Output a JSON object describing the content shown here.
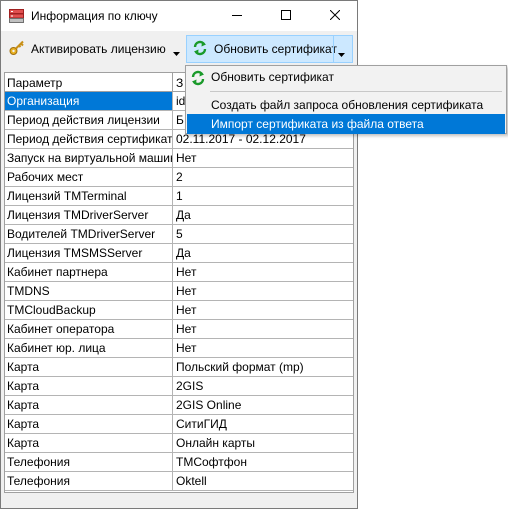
{
  "window": {
    "title": "Информация по ключу"
  },
  "toolbar": {
    "activate_label": "Активировать лицензию",
    "update_label": "Обновить сертификат"
  },
  "grid": {
    "headers": [
      "Параметр",
      "З"
    ],
    "rows": [
      {
        "key": "Организация",
        "value": "id"
      },
      {
        "key": "Период действия лицензии",
        "value": "Б"
      },
      {
        "key": "Период действия сертификата",
        "value": "02.11.2017 - 02.12.2017"
      },
      {
        "key": "Запуск на виртуальной машине",
        "value": "Нет"
      },
      {
        "key": "Рабочих мест",
        "value": "2"
      },
      {
        "key": "Лицензий TMTerminal",
        "value": "1"
      },
      {
        "key": "Лицензия TMDriverServer",
        "value": "Да"
      },
      {
        "key": "Водителей TMDriverServer",
        "value": "5"
      },
      {
        "key": "Лицензия TMSMSServer",
        "value": "Да"
      },
      {
        "key": "Кабинет партнера",
        "value": "Нет"
      },
      {
        "key": "TMDNS",
        "value": "Нет"
      },
      {
        "key": "TMCloudBackup",
        "value": "Нет"
      },
      {
        "key": "Кабинет оператора",
        "value": "Нет"
      },
      {
        "key": "Кабинет юр. лица",
        "value": "Нет"
      },
      {
        "key": "Карта",
        "value": "Польский формат (mp)"
      },
      {
        "key": "Карта",
        "value": "2GIS"
      },
      {
        "key": "Карта",
        "value": "2GIS Online"
      },
      {
        "key": "Карта",
        "value": "СитиГИД"
      },
      {
        "key": "Карта",
        "value": "Онлайн карты"
      },
      {
        "key": "Телефония",
        "value": "ТМСофтфон"
      },
      {
        "key": "Телефония",
        "value": "Oktell"
      }
    ]
  },
  "menu": {
    "items": [
      "Обновить сертификат",
      "Создать файл запроса обновления сертификата",
      "Импорт сертификата из файла ответа"
    ],
    "highlighted_index": 2
  },
  "colors": {
    "accent": "#0078d7",
    "hover": "#cce8ff"
  },
  "icons": [
    "app-key-icon",
    "key-icon",
    "refresh-certificate-icon",
    "chevron-down-icon",
    "minimize-icon",
    "maximize-icon",
    "close-icon"
  ]
}
